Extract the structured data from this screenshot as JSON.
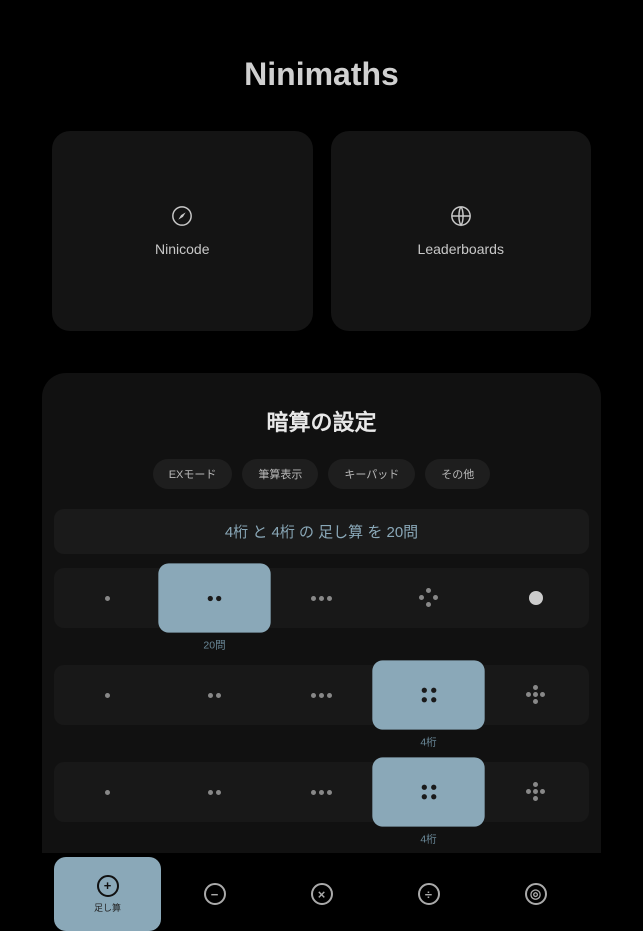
{
  "title": "Ninimaths",
  "cards": [
    {
      "label": "Ninicode",
      "icon": "compass"
    },
    {
      "label": "Leaderboards",
      "icon": "globe"
    }
  ],
  "settings": {
    "title": "暗算の設定",
    "chips": [
      "EXモード",
      "筆算表示",
      "キーパッド",
      "その他"
    ],
    "summary": "4桁 と 4桁 の 足し算 を 20問",
    "row1": {
      "selectedIndex": 1,
      "selectedLabel": "20問"
    },
    "row2": {
      "selectedIndex": 3,
      "selectedLabel": "4桁"
    },
    "row3": {
      "selectedIndex": 3,
      "selectedLabel": "4桁"
    },
    "operations": {
      "selectedIndex": 0,
      "items": [
        {
          "symbol": "+",
          "label": "足し算"
        },
        {
          "symbol": "−",
          "label": ""
        },
        {
          "symbol": "×",
          "label": ""
        },
        {
          "symbol": "÷",
          "label": ""
        },
        {
          "symbol": "◎",
          "label": ""
        }
      ]
    }
  }
}
